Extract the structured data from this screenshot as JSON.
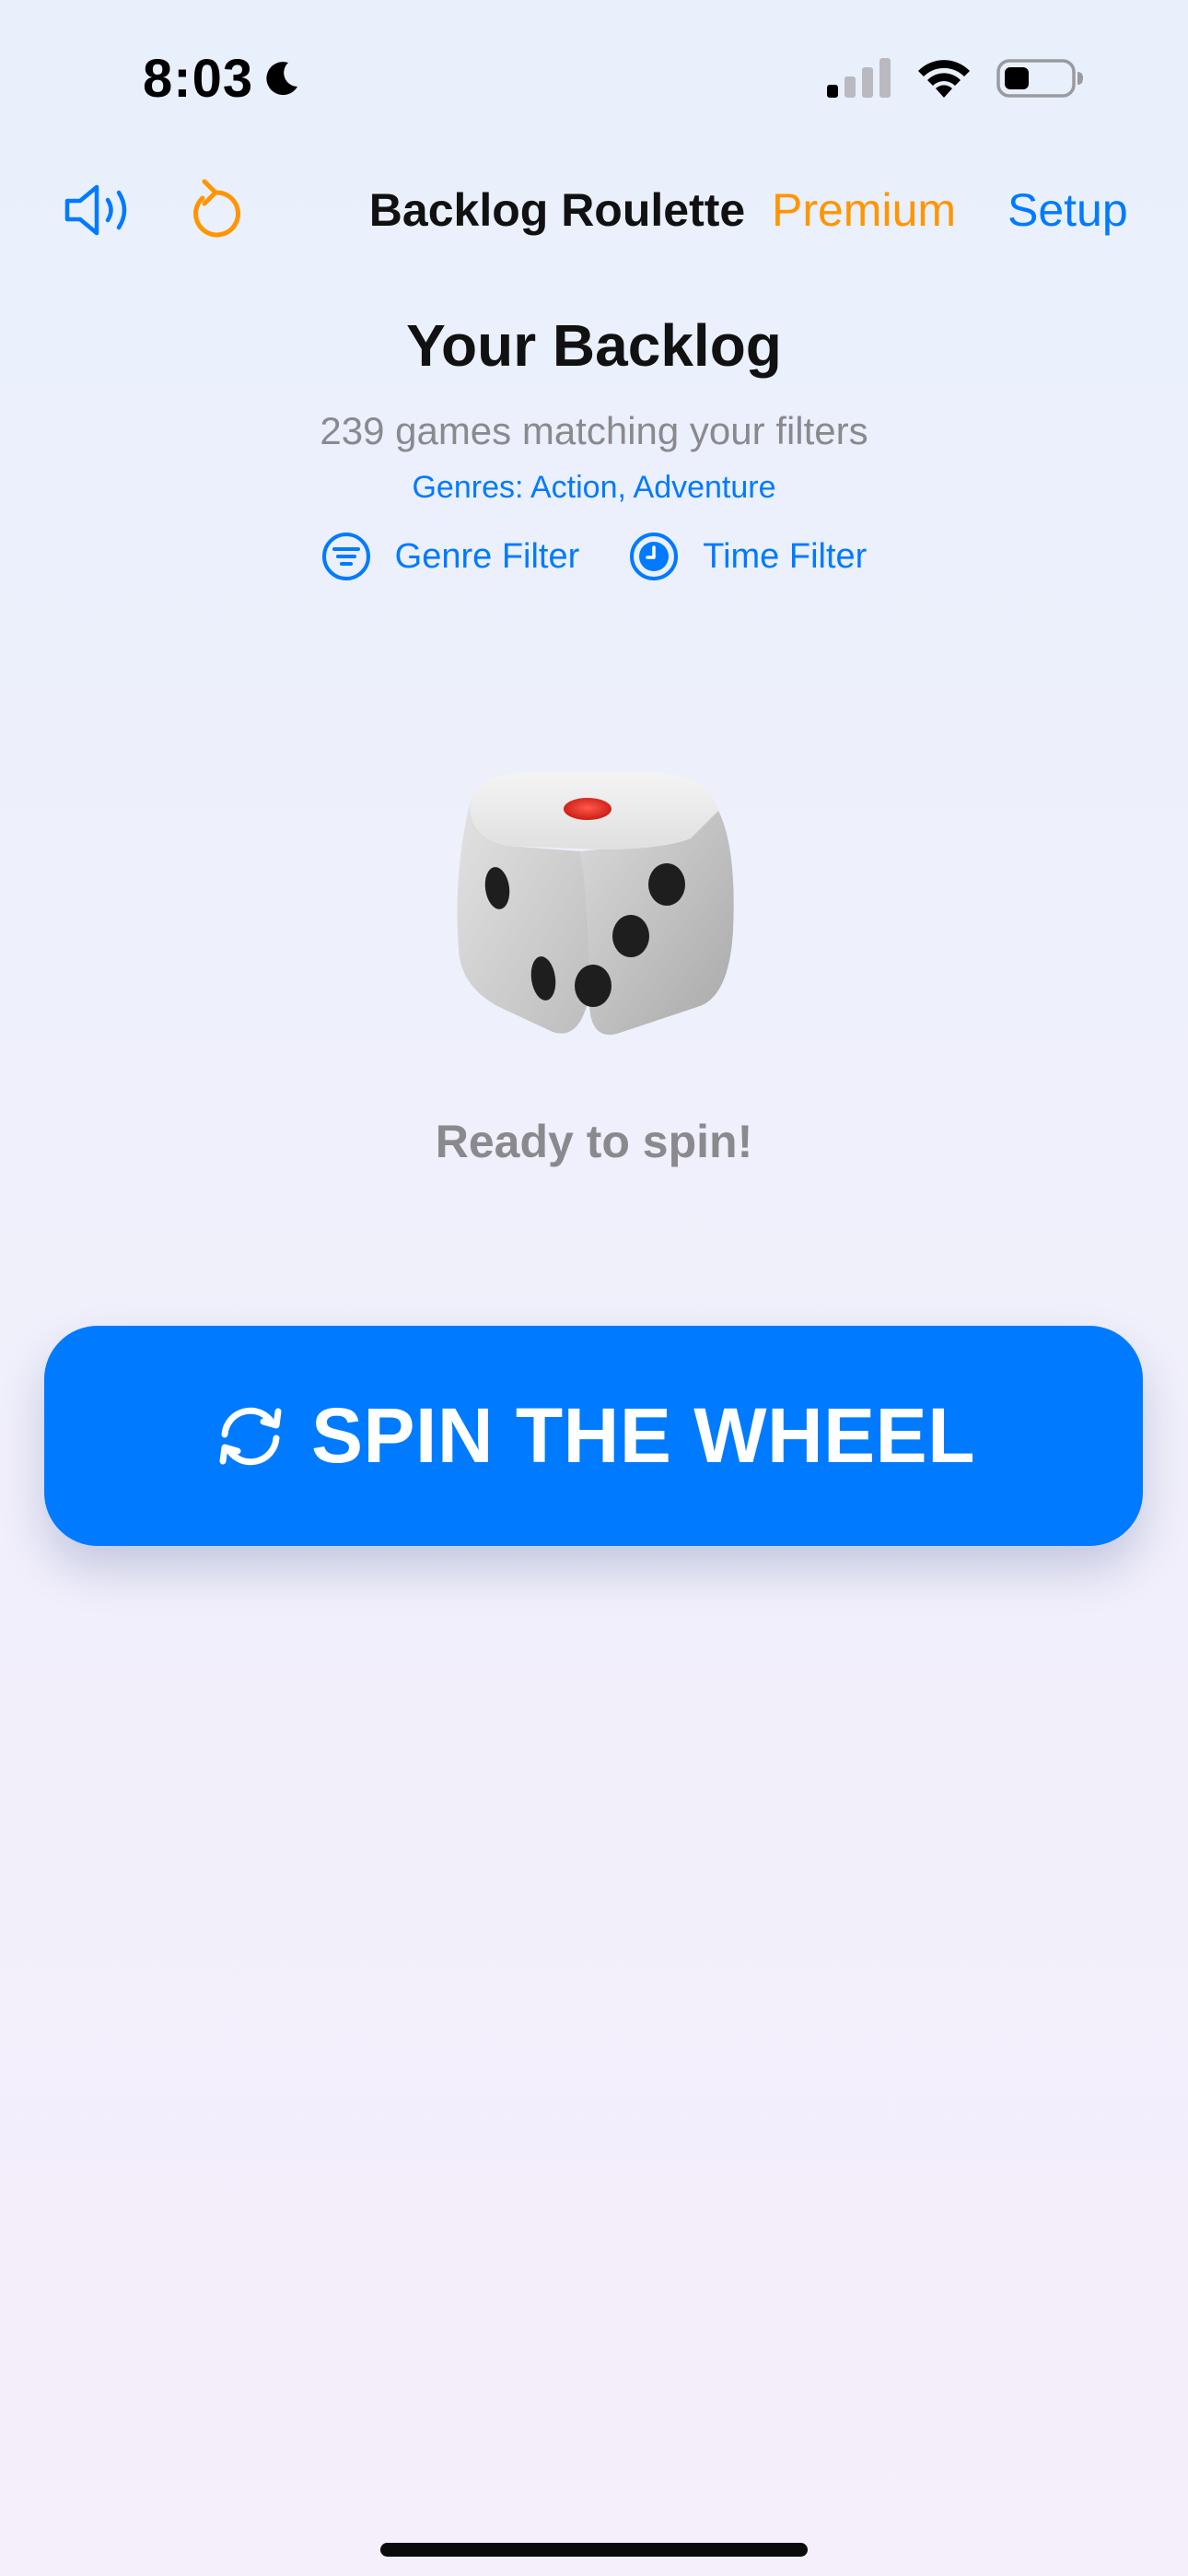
{
  "status_bar": {
    "time": "8:03",
    "icons": [
      "moon-icon",
      "cellular-signal-icon",
      "wifi-icon",
      "battery-icon"
    ]
  },
  "nav": {
    "sound_icon": "speaker-icon",
    "reset_icon": "counterclockwise-arrow-icon",
    "title": "Backlog Roulette",
    "premium_label": "Premium",
    "setup_label": "Setup"
  },
  "backlog": {
    "title": "Your Backlog",
    "games_count_text": "239 games matching your filters",
    "genres_text": "Genres: Action, Adventure",
    "filters": [
      {
        "label": "Genre Filter",
        "icon": "filter-lines-icon"
      },
      {
        "label": "Time Filter",
        "icon": "clock-icon"
      }
    ]
  },
  "dice": {
    "icon": "dice-icon"
  },
  "status_message": "Ready to spin!",
  "spin_button": {
    "label": "SPIN THE WHEEL",
    "icon": "refresh-arrows-icon"
  },
  "colors": {
    "accent_blue": "#007aff",
    "premium_orange": "#ff9500",
    "secondary_gray": "#8a8a8e"
  }
}
